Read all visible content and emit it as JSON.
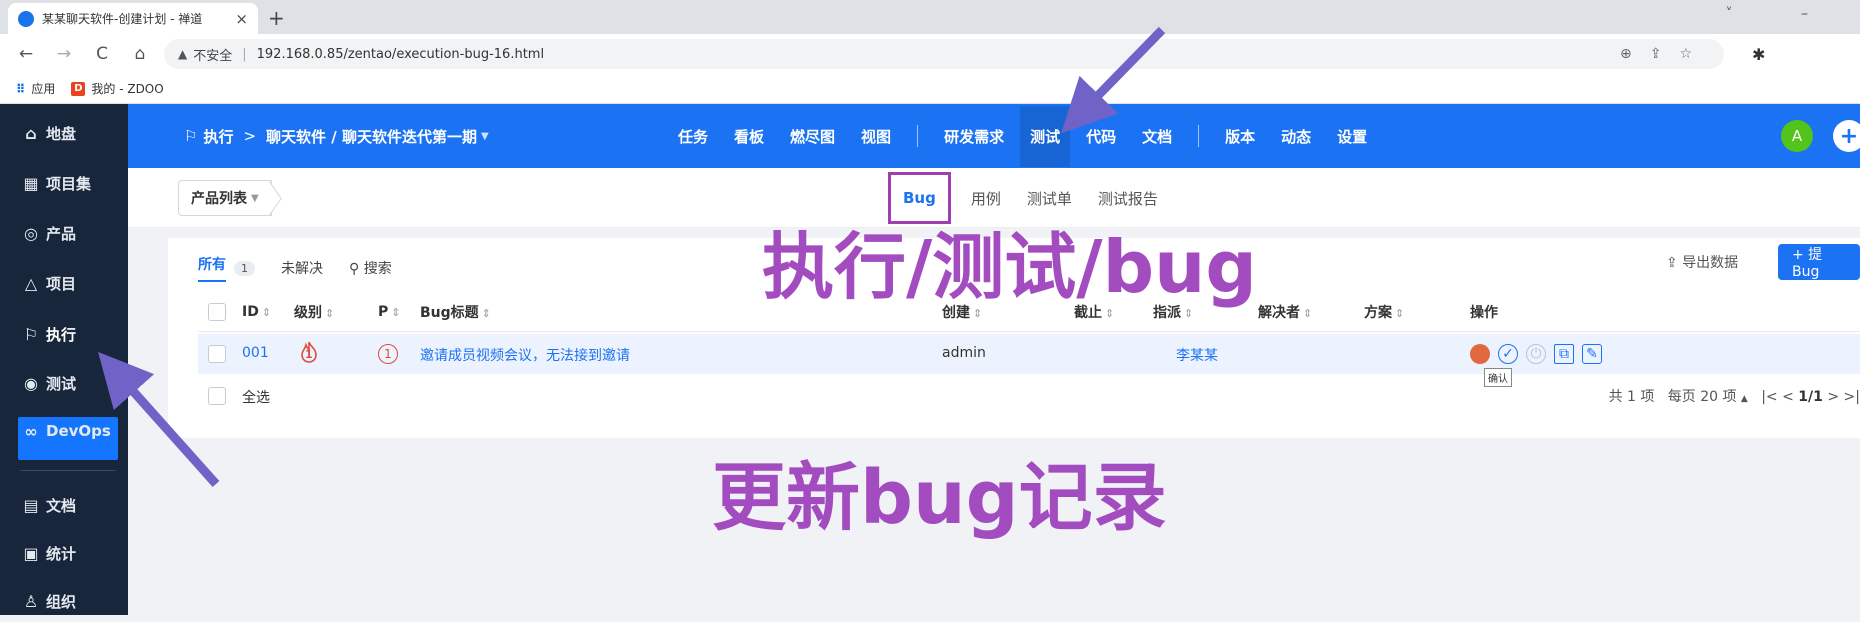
{
  "browser": {
    "tab_title": "某某聊天软件-创建计划 - 禅道",
    "tab_close": "×",
    "new_tab": "+",
    "window_controls": "˅ –",
    "security_label": "不安全",
    "url": "192.168.0.85/zentao/execution-bug-16.html",
    "bookmarks": [
      {
        "label": "应用"
      },
      {
        "label": "我的 - ZDOO"
      }
    ]
  },
  "sidebar": {
    "items": [
      {
        "label": "地盘",
        "icon": "home-icon"
      },
      {
        "label": "项目集",
        "icon": "grid-icon"
      },
      {
        "label": "产品",
        "icon": "lightbulb-icon"
      },
      {
        "label": "项目",
        "icon": "rocket-icon"
      },
      {
        "label": "执行",
        "icon": "run-icon"
      },
      {
        "label": "测试",
        "icon": "magnifier-icon"
      },
      {
        "label": "DevOps",
        "icon": "infinity-icon"
      },
      {
        "label": "文档",
        "icon": "document-icon"
      },
      {
        "label": "统计",
        "icon": "chart-icon"
      },
      {
        "label": "组织",
        "icon": "people-icon"
      }
    ]
  },
  "header": {
    "breadcrumb_root": "执行",
    "breadcrumb_arrow": ">",
    "breadcrumb_current": "聊天软件 / 聊天软件迭代第一期",
    "nav": [
      "任务",
      "看板",
      "燃尽图",
      "视图",
      "研发需求",
      "测试",
      "代码",
      "文档",
      "版本",
      "动态",
      "设置"
    ],
    "avatar_letter": "A",
    "plus": "+"
  },
  "subnav": {
    "product_list": "产品列表",
    "tabs": [
      "Bug",
      "用例",
      "测试单",
      "测试报告"
    ]
  },
  "toolbar": {
    "filter_all": "所有",
    "filter_all_count": "1",
    "filter_unresolved": "未解决",
    "search": "搜索",
    "export": "导出数据",
    "report_bug": "+ 提Bug"
  },
  "table": {
    "headers": [
      "ID",
      "级别",
      "P",
      "Bug标题",
      "创建",
      "截止",
      "指派",
      "解决者",
      "方案",
      "操作"
    ],
    "rows": [
      {
        "id": "001",
        "severity": "1",
        "priority": "1",
        "title": "邀请成员视频会议，无法接到邀请",
        "creator": "admin",
        "deadline": "",
        "assigned": "李某某",
        "resolver": "",
        "resolution": ""
      }
    ],
    "tooltip": "确认",
    "select_all": "全选",
    "pager": {
      "total": "共 1 项",
      "per_page": "每页 20 项",
      "pages": "1/1"
    }
  },
  "annotations": {
    "title": "执行/测试/bug",
    "subtitle": "更新bug记录"
  },
  "colors": {
    "header_blue": "#1b72f2",
    "sidebar_bg": "#17263b",
    "annotation_purple": "#a24cc0",
    "arrow_purple": "#6f63c8"
  }
}
